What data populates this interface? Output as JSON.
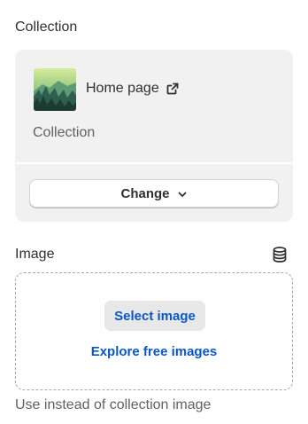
{
  "collection": {
    "section_label": "Collection",
    "card": {
      "title": "Home page",
      "subtitle": "Collection",
      "title_icon": "external-link-icon",
      "thumbnail": "forest-landscape-thumbnail",
      "change_label": "Change",
      "change_icon": "chevron-down-icon"
    }
  },
  "image": {
    "section_label": "Image",
    "header_icon": "database-icon",
    "select_label": "Select image",
    "explore_label": "Explore free images",
    "helper_text": "Use instead of collection image"
  },
  "colors": {
    "link_blue": "#0b57c2",
    "card_bg": "#f1f1f1",
    "text": "#303030",
    "muted_text": "#616161"
  }
}
